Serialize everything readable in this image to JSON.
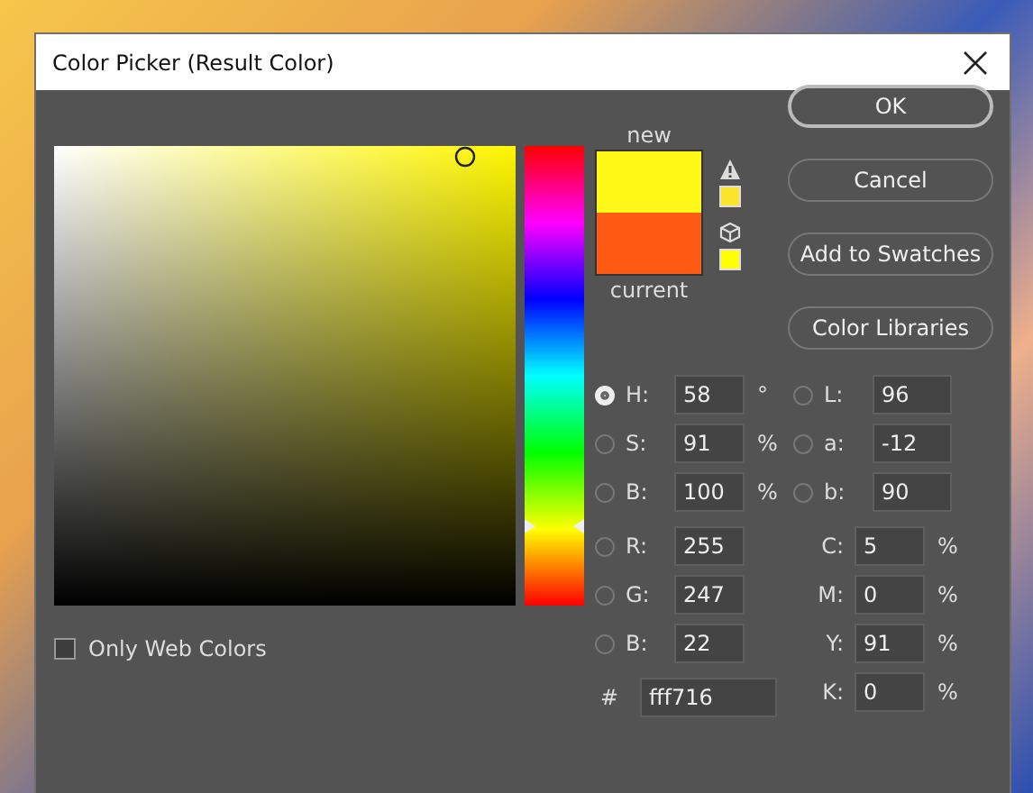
{
  "window": {
    "title": "Color Picker (Result Color)"
  },
  "picker": {
    "hue_slider": {
      "level": 0.16
    }
  },
  "preview": {
    "new_label": "new",
    "current_label": "current",
    "swatches": [
      {
        "color": "#fff716"
      },
      {
        "color": "#ff5a14"
      }
    ]
  },
  "warnings": [
    {
      "kind": "gamut",
      "color": "#fbe52c"
    },
    {
      "kind": "web",
      "color": "#ffff00"
    }
  ],
  "buttons": [
    {
      "label": "OK",
      "default": true
    },
    {
      "label": "Cancel",
      "default": false
    },
    {
      "label": "Add to Swatches",
      "default": false
    },
    {
      "label": "Color Libraries",
      "default": false
    }
  ],
  "hsb_lab": [
    {
      "label": "H:",
      "value": "58",
      "unit": "°",
      "selected": true
    },
    {
      "label": "L:",
      "value": "96",
      "selected": false
    },
    {
      "label": "S:",
      "value": "91",
      "unit": "%",
      "selected": false
    },
    {
      "label": "a:",
      "value": "-12",
      "selected": false
    },
    {
      "label": "B:",
      "value": "100",
      "unit": "%",
      "selected": false
    },
    {
      "label": "b:",
      "value": "90",
      "selected": false
    }
  ],
  "rgb": [
    {
      "label": "R:",
      "value": "255",
      "selected": false
    },
    {
      "label": "G:",
      "value": "247",
      "selected": false
    },
    {
      "label": "B:",
      "value": "22",
      "selected": false
    }
  ],
  "hex": {
    "label": "#",
    "value": "fff716"
  },
  "cmyk": [
    {
      "label": "C:",
      "value": "5",
      "unit": "%"
    },
    {
      "label": "M:",
      "value": "0",
      "unit": "%"
    },
    {
      "label": "Y:",
      "value": "91",
      "unit": "%"
    },
    {
      "label": "K:",
      "value": "0",
      "unit": "%"
    }
  ],
  "only_web_colors": {
    "label": "Only Web Colors",
    "checked": false
  }
}
